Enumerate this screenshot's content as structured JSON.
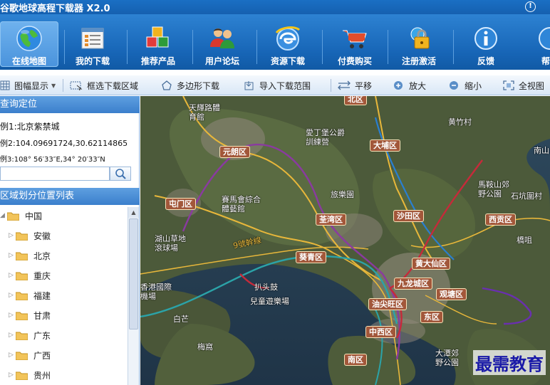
{
  "app": {
    "title": "谷歌地球高程下载器 X2.0"
  },
  "nav": [
    {
      "label": "在线地图",
      "icon": "globe-icon",
      "active": true
    },
    {
      "label": "我的下载",
      "icon": "download-list-icon"
    },
    {
      "label": "推荐产品",
      "icon": "cubes-icon"
    },
    {
      "label": "用户论坛",
      "icon": "users-icon"
    },
    {
      "label": "资源下载",
      "icon": "ie-browser-icon"
    },
    {
      "label": "付费购买",
      "icon": "cart-icon"
    },
    {
      "label": "注册激活",
      "icon": "key-lock-icon"
    },
    {
      "label": "反馈",
      "icon": "info-icon"
    },
    {
      "label": "帮",
      "icon": "help-icon"
    }
  ],
  "toolbar": {
    "display": "图幅显示",
    "box_select": "框选下载区域",
    "polygon": "多边形下载",
    "import": "导入下载范围",
    "pan": "平移",
    "zoom_in": "放大",
    "zoom_out": "缩小",
    "full_view": "全视图"
  },
  "query": {
    "header": "查询定位",
    "example1": "例1:北京紫禁城",
    "example2": "例2:104.09691724,30.62114865",
    "example3": "例3:108° 56′33″E,34° 20′33″N",
    "input_value": ""
  },
  "region": {
    "header": "区域划分位置列表",
    "root": "中国",
    "items": [
      "安徽",
      "北京",
      "重庆",
      "福建",
      "甘肃",
      "广东",
      "广西",
      "贵州"
    ]
  },
  "map": {
    "districts": [
      "北区",
      "大埔区",
      "元朗区",
      "屯门区",
      "荃湾区",
      "沙田区",
      "西贡区",
      "葵青区",
      "黄大仙区",
      "九龙城区",
      "观塘区",
      "油尖旺区",
      "东区",
      "中西区",
      "南区"
    ],
    "places": [
      "天輝路體育館",
      "愛丁堡公爵訓練營",
      "黄竹村",
      "賽馬會綜合體藝館",
      "旅樂園",
      "馬鞍山郊野公園",
      "石坑圍村",
      "湖山草地滾球場",
      "橋咀",
      "香港國際機場",
      "扒头鼓",
      "兒童遊樂場",
      "白芒",
      "梅窩",
      "大潭郊野公園",
      "南山",
      "9號幹線"
    ]
  },
  "watermark": "最需教育",
  "colors": {
    "nav_bg": "#1765b6",
    "district_bg": "#a2573a",
    "panel_header": "#4a8bd4"
  }
}
